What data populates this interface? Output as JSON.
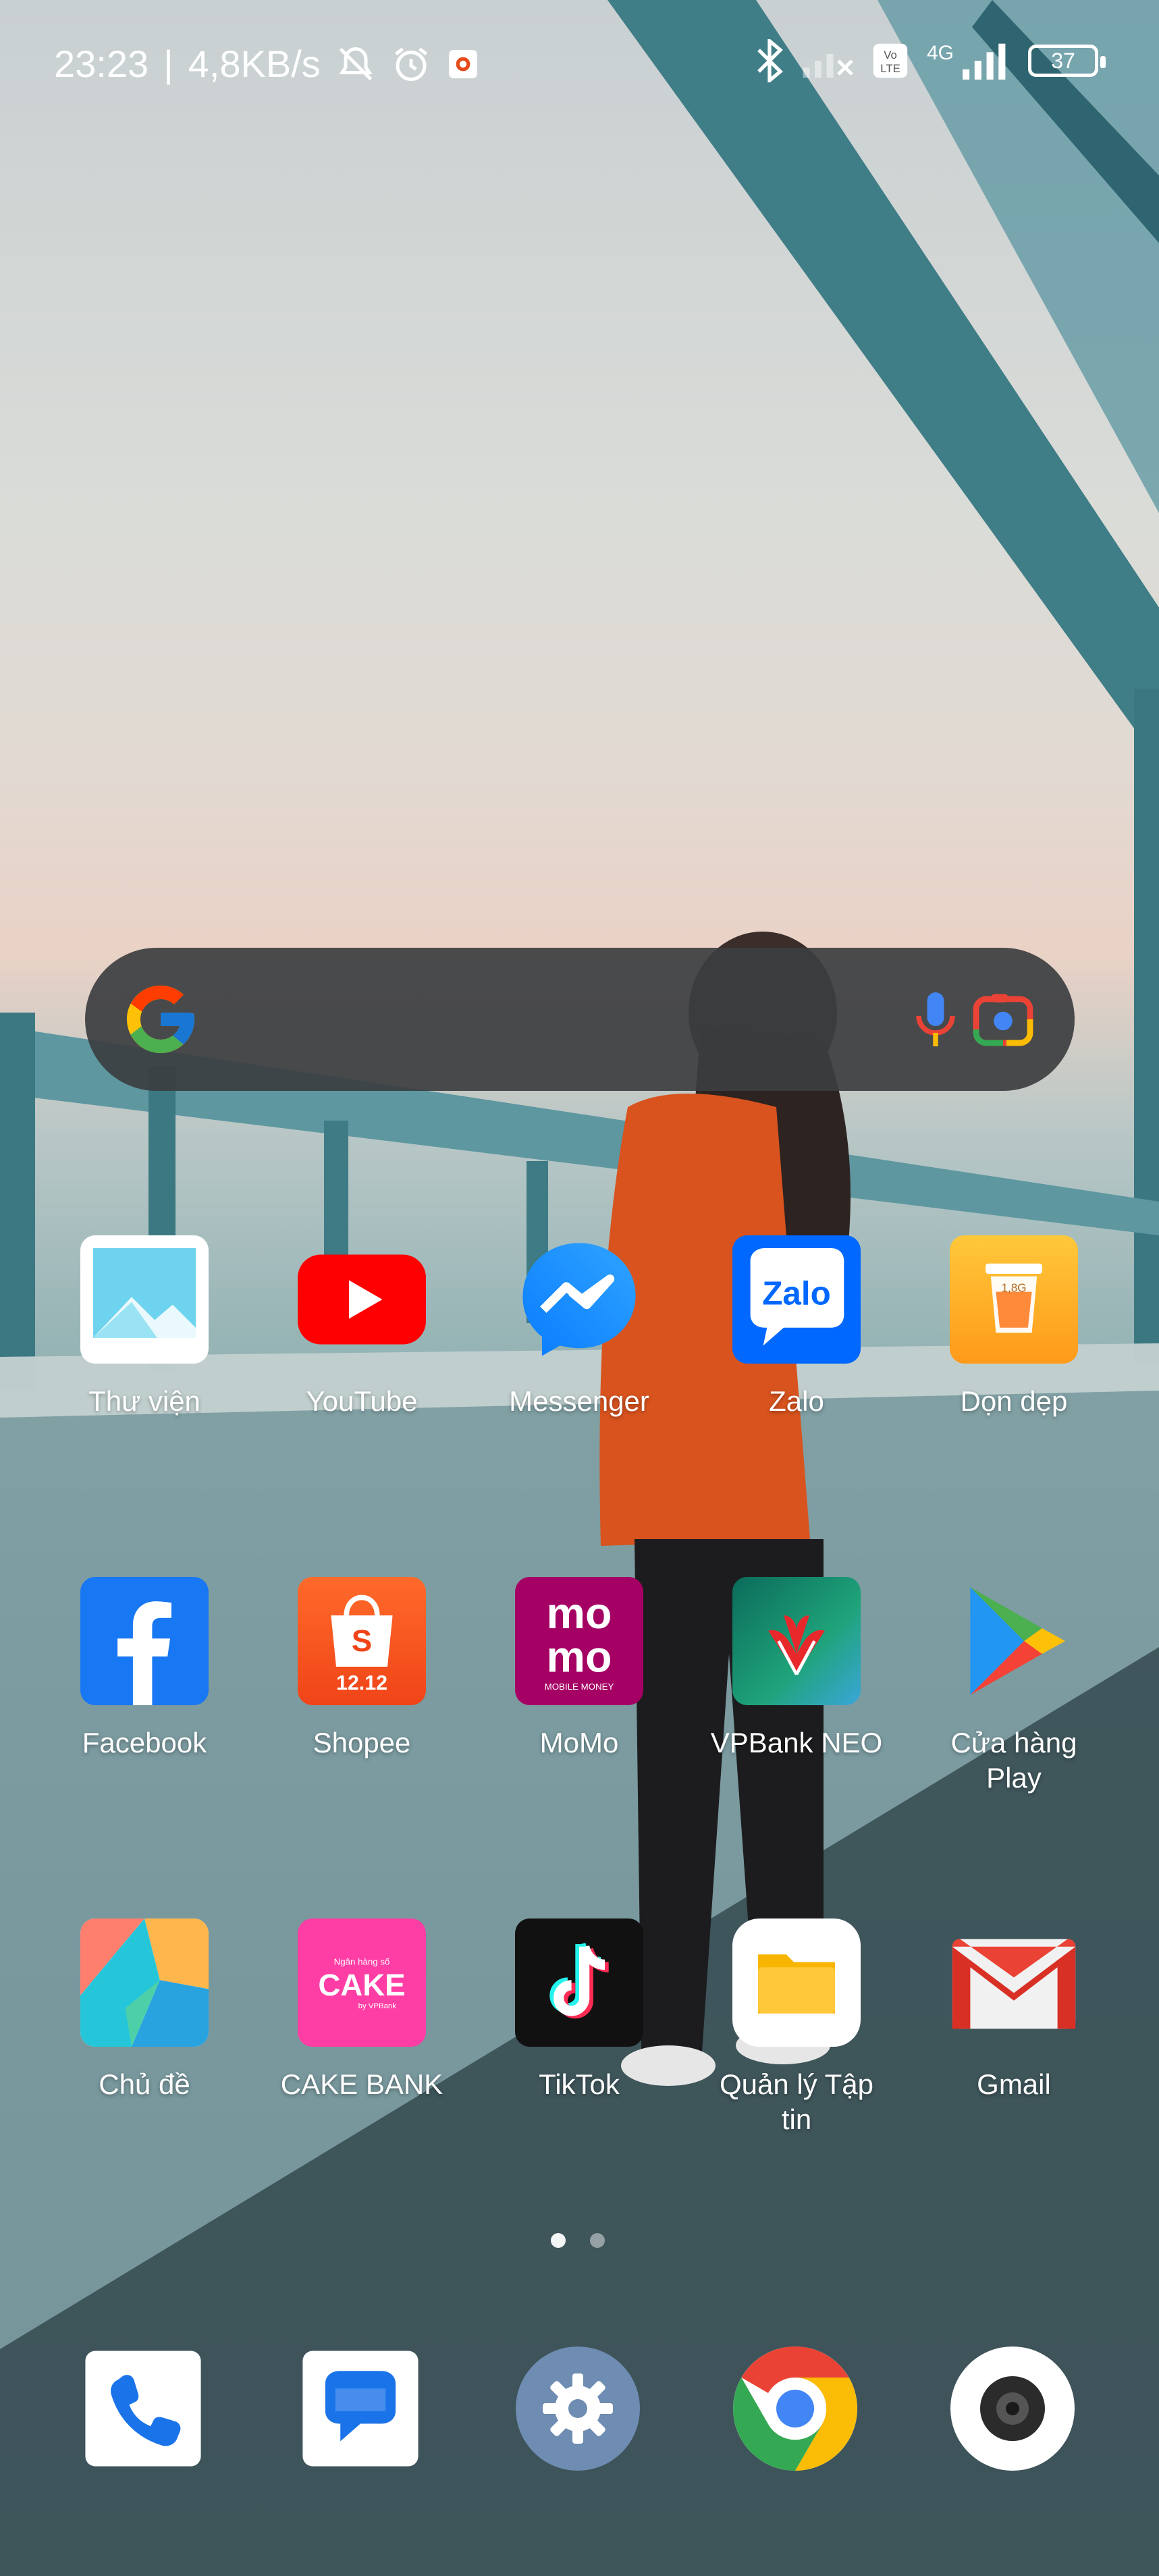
{
  "status_bar": {
    "time": "23:23",
    "separator": "|",
    "speed": "4,8KB/s",
    "network": "4G",
    "battery": "37"
  },
  "search_bar": {
    "placeholder": ""
  },
  "apps": [
    {
      "label": "Thư viện",
      "icon": "gallery-icon"
    },
    {
      "label": "YouTube",
      "icon": "youtube-icon"
    },
    {
      "label": "Messenger",
      "icon": "messenger-icon"
    },
    {
      "label": "Zalo",
      "icon": "zalo-icon"
    },
    {
      "label": "Dọn dẹp",
      "icon": "cleaner-icon"
    },
    {
      "label": "Facebook",
      "icon": "facebook-icon"
    },
    {
      "label": "Shopee",
      "icon": "shopee-icon"
    },
    {
      "label": "MoMo",
      "icon": "momo-icon"
    },
    {
      "label": "VPBank NEO",
      "icon": "vpbank-icon"
    },
    {
      "label": "Cửa hàng Play",
      "icon": "play-store-icon"
    },
    {
      "label": "Chủ đề",
      "icon": "themes-icon"
    },
    {
      "label": "CAKE BANK",
      "icon": "cake-bank-icon"
    },
    {
      "label": "TikTok",
      "icon": "tiktok-icon"
    },
    {
      "label": "Quản lý Tập tin",
      "icon": "file-manager-icon"
    },
    {
      "label": "Gmail",
      "icon": "gmail-icon"
    }
  ],
  "icon_text": {
    "zalo": "Zalo",
    "cleaner": "1,8G",
    "shopee": "12.12",
    "momo_top": "mo",
    "momo_bottom": "mo",
    "momo_sub": "MOBILE MONEY",
    "cake": "CAKE",
    "cake_top": "Ngân hàng số",
    "cake_sub": "by VPBank"
  },
  "dock": [
    {
      "icon": "phone-icon"
    },
    {
      "icon": "messages-icon"
    },
    {
      "icon": "settings-icon"
    },
    {
      "icon": "chrome-icon"
    },
    {
      "icon": "camera-icon"
    }
  ],
  "pager": {
    "pages": 2,
    "current": 1
  }
}
